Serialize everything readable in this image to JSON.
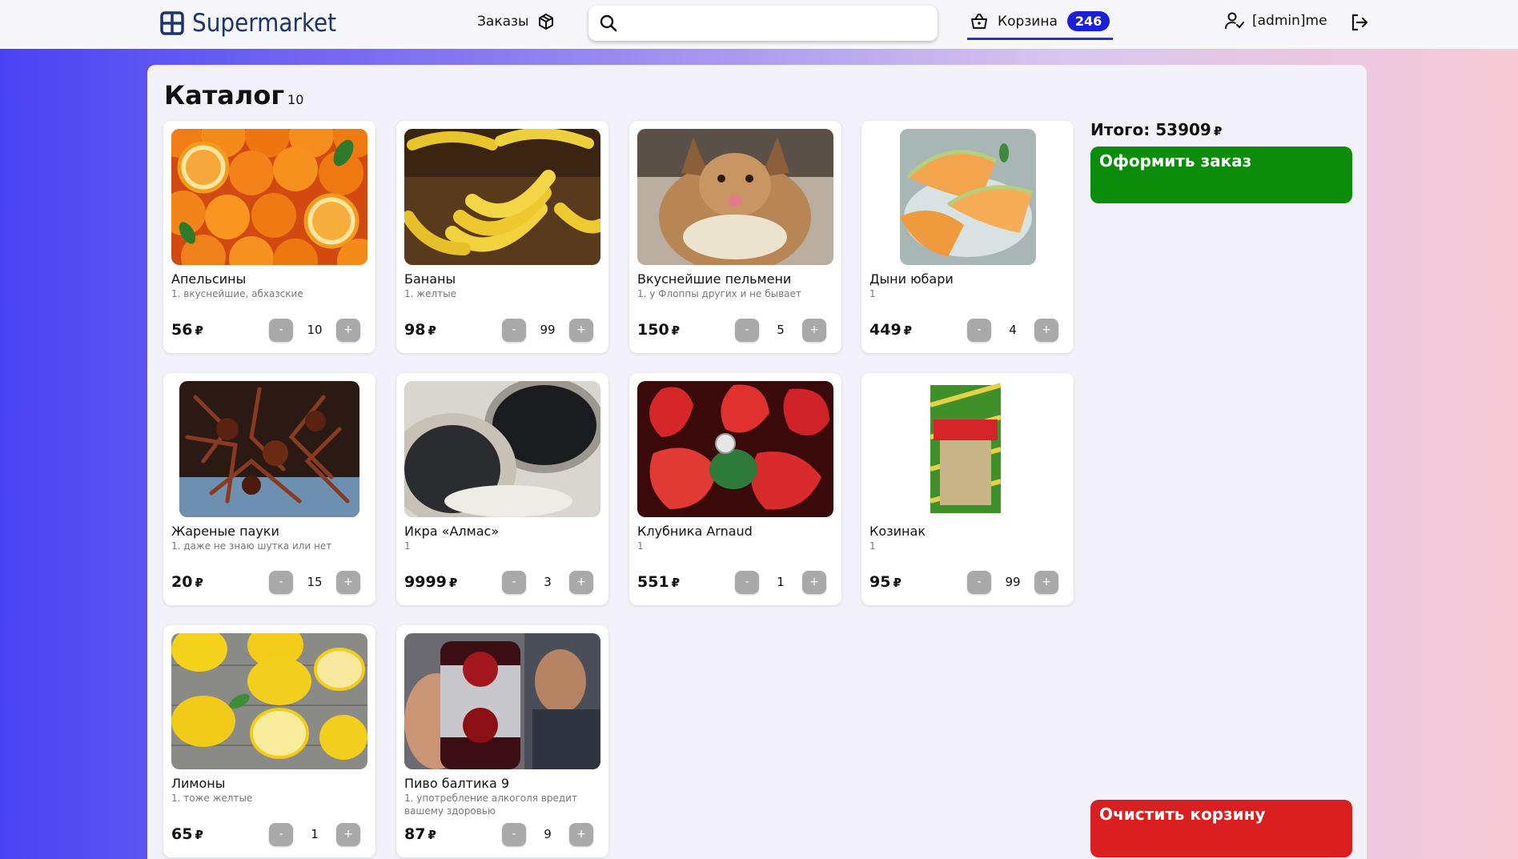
{
  "app": {
    "title": "Supermarket"
  },
  "nav": {
    "orders_label": "Заказы",
    "search_placeholder": "",
    "search_value": "",
    "cart_label": "Корзина",
    "cart_count": "246",
    "user_name": "[admin]me"
  },
  "catalog": {
    "title": "Каталог",
    "count": "10"
  },
  "currency": "₽",
  "products": [
    {
      "name": "Апельсины",
      "desc": "1. вкуснейшие, абхазские",
      "price": "56",
      "qty": "10",
      "image": "oranges"
    },
    {
      "name": "Бананы",
      "desc": "1. желтые",
      "price": "98",
      "qty": "99",
      "image": "bananas"
    },
    {
      "name": "Вкуснейшие пельмени",
      "desc": "1. у Флоппы других и не бывает",
      "price": "150",
      "qty": "5",
      "image": "caracal-dumpling"
    },
    {
      "name": "Дыни юбари",
      "desc": "1",
      "price": "449",
      "qty": "4",
      "image": "melon"
    },
    {
      "name": "Жареные пауки",
      "desc": "1. даже не знаю шутка или нет",
      "price": "20",
      "qty": "15",
      "image": "fried-spiders"
    },
    {
      "name": "Икра «Алмас»",
      "desc": "1",
      "price": "9999",
      "qty": "3",
      "image": "caviar"
    },
    {
      "name": "Клубника Arnaud",
      "desc": "1",
      "price": "551",
      "qty": "1",
      "image": "strawberries"
    },
    {
      "name": "Козинак",
      "desc": "1",
      "price": "95",
      "qty": "99",
      "image": "kozinak"
    },
    {
      "name": "Лимоны",
      "desc": "1. тоже желтые",
      "price": "65",
      "qty": "1",
      "image": "lemons"
    },
    {
      "name": "Пиво балтика 9",
      "desc": "1. употребление алкоголя вредит вашему здоровью",
      "price": "87",
      "qty": "9",
      "image": "baltika-beer"
    }
  ],
  "qty_controls": {
    "minus": "-",
    "plus": "+"
  },
  "sidebar": {
    "total_label": "Итого:",
    "total_value": "53909",
    "checkout_label": "Оформить заказ",
    "clear_label": "Очистить корзину"
  },
  "colors": {
    "checkout": "#0b8d0b",
    "clear": "#d91f1f",
    "badge": "#1b1fd6",
    "logo": "#1a3570"
  },
  "icons": {
    "logo": "grid-cart-icon",
    "orders": "box-icon",
    "search": "search-icon",
    "cart": "basket-icon",
    "user": "user-check-icon",
    "logout": "logout-icon"
  }
}
